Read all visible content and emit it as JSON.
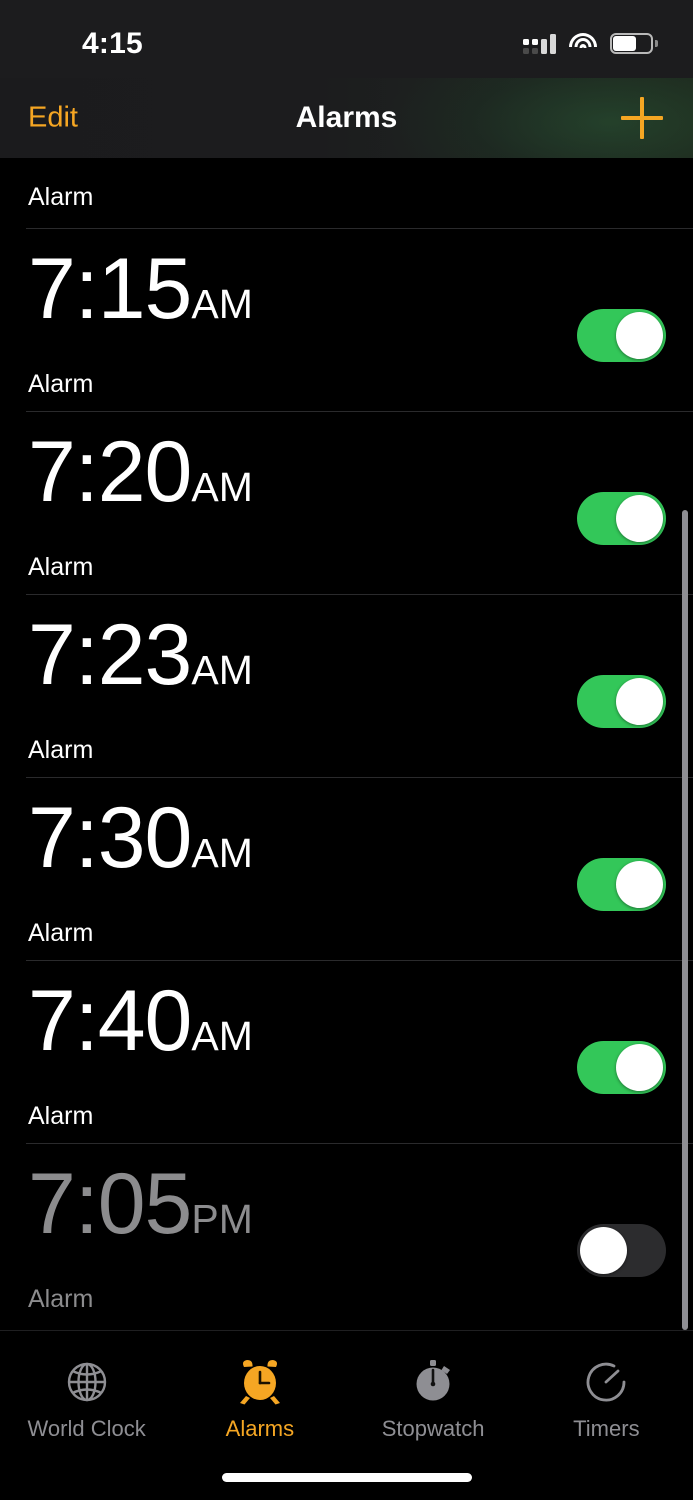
{
  "status_bar": {
    "time": "4:15",
    "cellular_icon": "cellular-signal-icon",
    "wifi_icon": "wifi-icon",
    "battery_icon": "battery-icon",
    "battery_level_pct": 62
  },
  "nav_bar": {
    "edit_label": "Edit",
    "title": "Alarms",
    "add_icon": "plus-icon"
  },
  "alarms": [
    {
      "time": "",
      "ampm": "",
      "label": "Alarm",
      "enabled": true,
      "partial": true
    },
    {
      "time": "7:15",
      "ampm": "AM",
      "label": "Alarm",
      "enabled": true,
      "partial": false
    },
    {
      "time": "7:20",
      "ampm": "AM",
      "label": "Alarm",
      "enabled": true,
      "partial": false
    },
    {
      "time": "7:23",
      "ampm": "AM",
      "label": "Alarm",
      "enabled": true,
      "partial": false
    },
    {
      "time": "7:30",
      "ampm": "AM",
      "label": "Alarm",
      "enabled": true,
      "partial": false
    },
    {
      "time": "7:40",
      "ampm": "AM",
      "label": "Alarm",
      "enabled": true,
      "partial": false
    },
    {
      "time": "7:05",
      "ampm": "PM",
      "label": "Alarm",
      "enabled": false,
      "partial": false
    }
  ],
  "tabs": [
    {
      "label": "World Clock",
      "icon": "globe-icon",
      "active": false
    },
    {
      "label": "Alarms",
      "icon": "alarm-clock-icon",
      "active": true
    },
    {
      "label": "Stopwatch",
      "icon": "stopwatch-icon",
      "active": false
    },
    {
      "label": "Timers",
      "icon": "timer-icon",
      "active": false
    }
  ],
  "colors": {
    "accent_orange": "#f5a623",
    "toggle_on_green": "#33c759",
    "toggle_off_gray": "#2c2c2e",
    "background": "#000000",
    "nav_background": "#1c1c1e",
    "inactive_text": "#8e8e93"
  }
}
